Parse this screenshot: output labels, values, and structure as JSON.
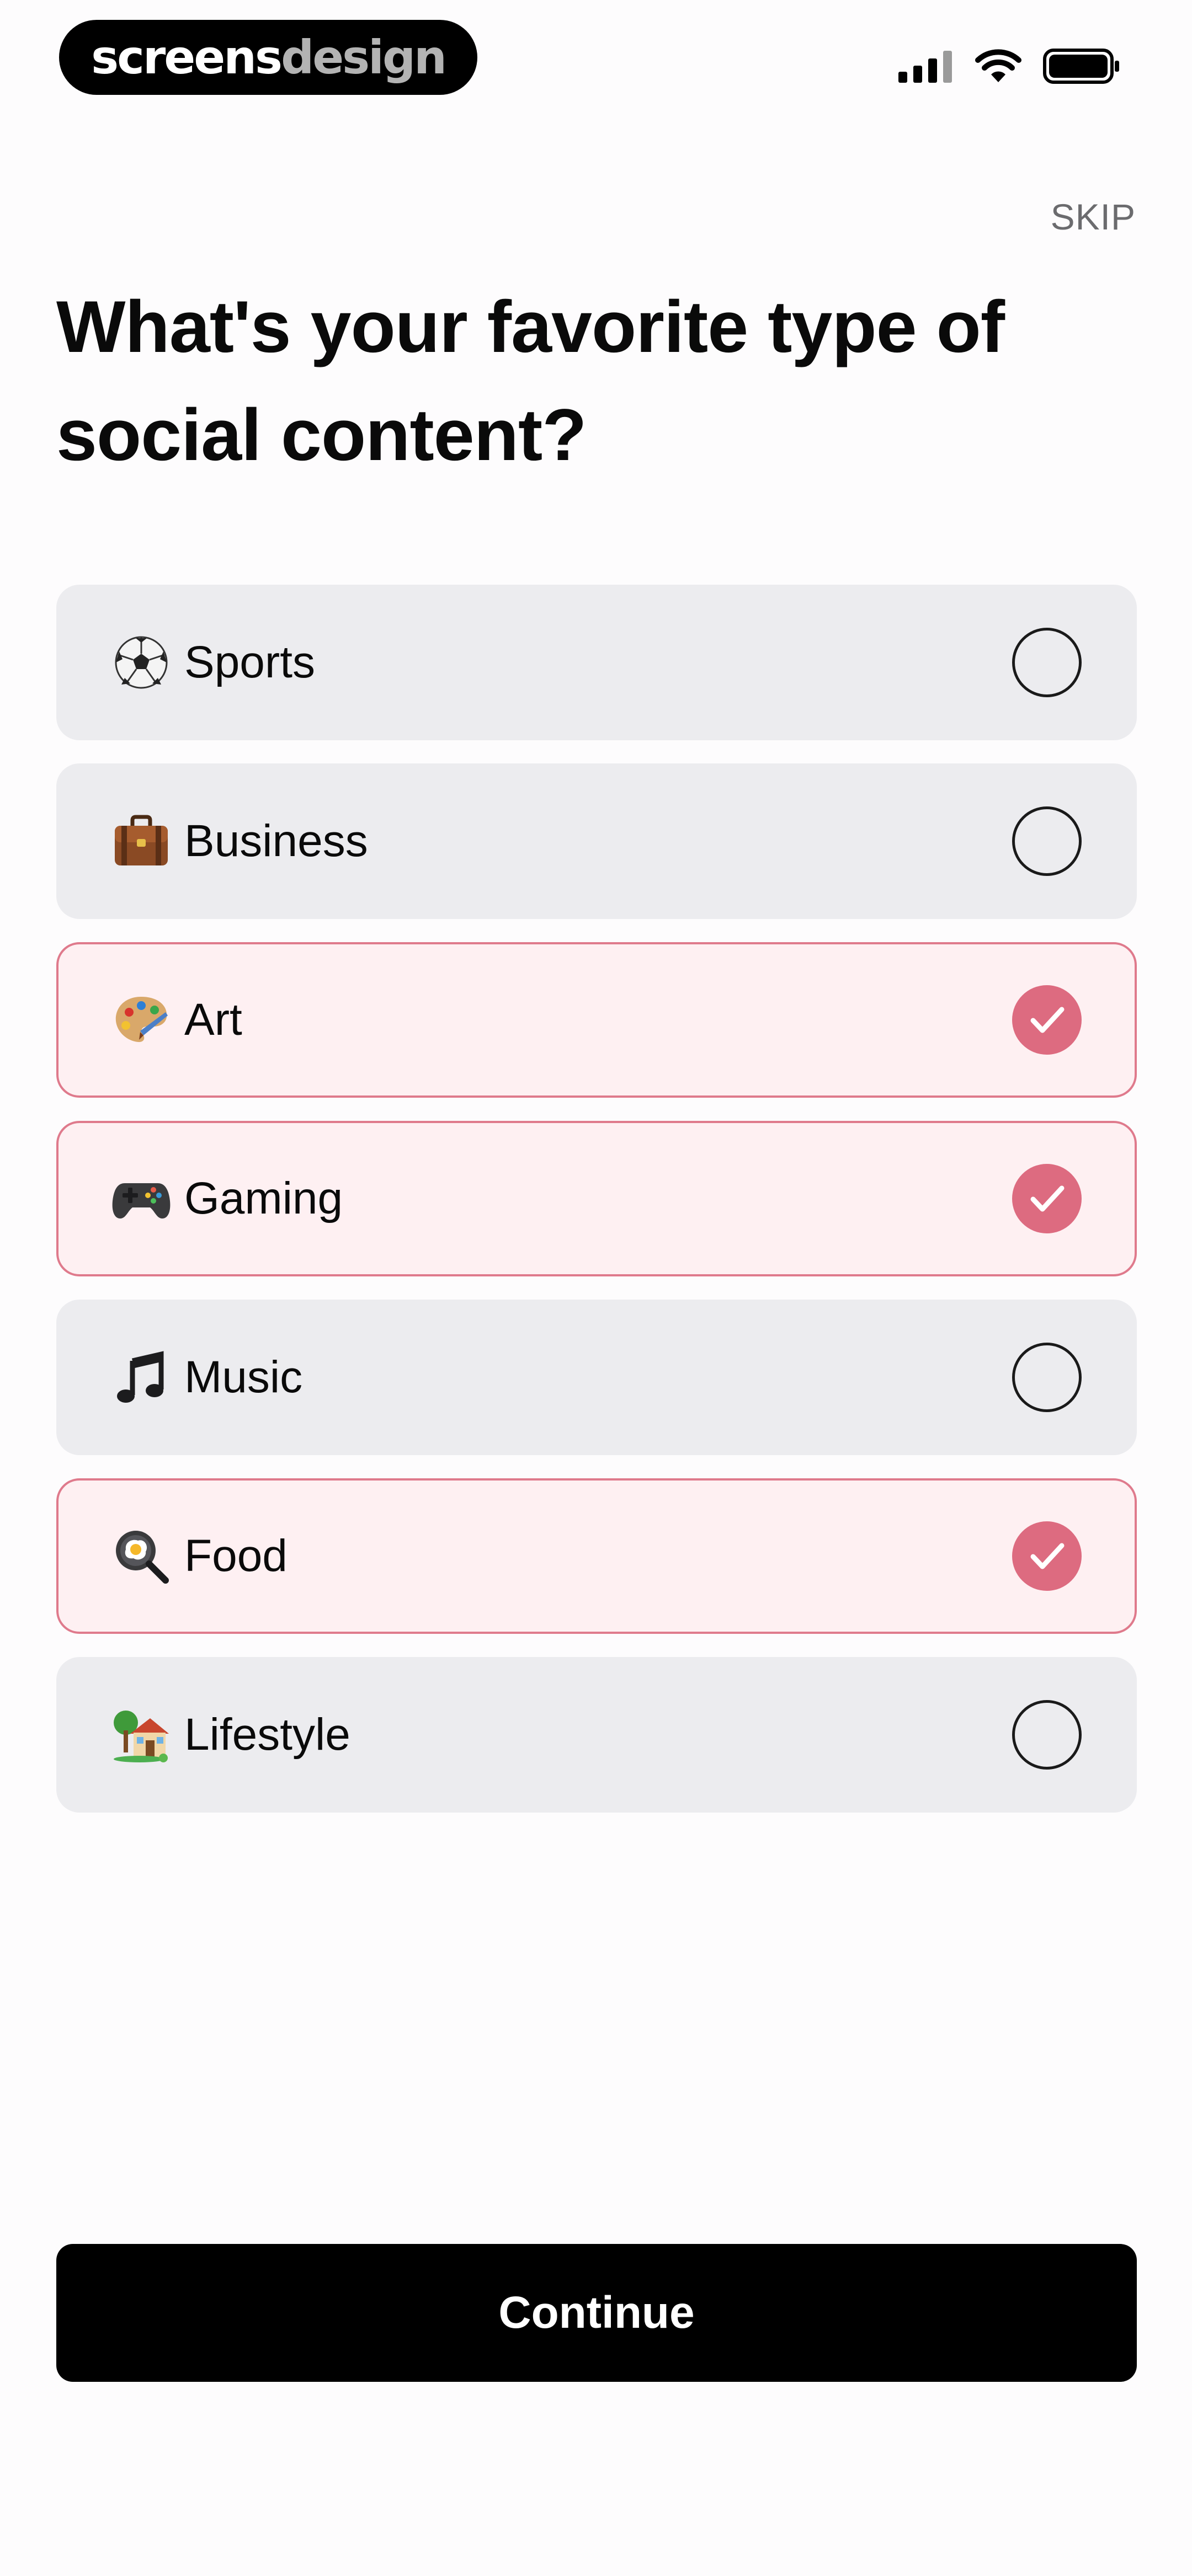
{
  "watermark": {
    "part1": "screens",
    "part2": "design"
  },
  "header": {
    "skip_label": "SKIP"
  },
  "title": "What's your favorite type of social content?",
  "options": [
    {
      "label": "Sports",
      "icon": "soccer-ball-icon",
      "selected": false
    },
    {
      "label": "Business",
      "icon": "briefcase-icon",
      "selected": false
    },
    {
      "label": "Art",
      "icon": "palette-icon",
      "selected": true
    },
    {
      "label": "Gaming",
      "icon": "game-controller-icon",
      "selected": true
    },
    {
      "label": "Music",
      "icon": "music-note-icon",
      "selected": false
    },
    {
      "label": "Food",
      "icon": "frying-pan-egg-icon",
      "selected": true
    },
    {
      "label": "Lifestyle",
      "icon": "house-with-garden-icon",
      "selected": false
    }
  ],
  "continue_label": "Continue",
  "colors": {
    "accent": "#dd6b80",
    "selected_bg": "#fef0f2",
    "selected_border": "#df7a8c",
    "option_bg": "#ececef",
    "button_bg": "#000000"
  }
}
